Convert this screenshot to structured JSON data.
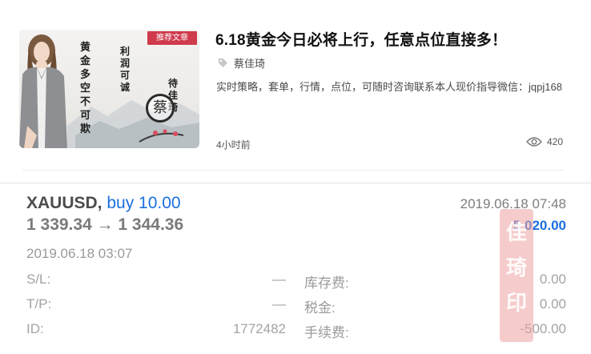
{
  "article": {
    "thumbnail": {
      "tag": "推荐文章",
      "calligraphy_left": "黄\n金\n多\n空\n不\n可\n欺",
      "calligraphy_right": "利\n润\n可\n诚",
      "calligraphy_right2": "待\n佳\n琦",
      "seal": "蔡"
    },
    "title": "6.18黄金今日必将上行，任意点位直接多！",
    "author": "蔡佳琦",
    "description": "实时策略，套单，行情，点位，可随时咨询联系本人现价指导微信：jqpj168",
    "time": "4小时前",
    "views": "420",
    "icons": {
      "author": "tag-icon",
      "views": "eye-icon"
    }
  },
  "trade": {
    "symbol": "XAUUSD,",
    "side": "buy 10.00",
    "price_range": "1 339.34 → 1 344.36",
    "close_time": "2019.06.18 07:48",
    "profit": "5 020.00",
    "open_time": "2019.06.18 03:07",
    "rows": [
      {
        "label": "S/L:",
        "value": "—",
        "label2": "库存费:",
        "value2": "0.00"
      },
      {
        "label": "T/P:",
        "value": "—",
        "label2": "税金:",
        "value2": "0.00"
      },
      {
        "label": "ID:",
        "value": "1772482",
        "label2": "手续费:",
        "value2": "-500.00"
      }
    ],
    "stamp": "佳\n琦\n印",
    "colors": {
      "buy": "#1a6fe0",
      "profit": "#1a6fe0",
      "stamp": "#eea0a0"
    }
  }
}
